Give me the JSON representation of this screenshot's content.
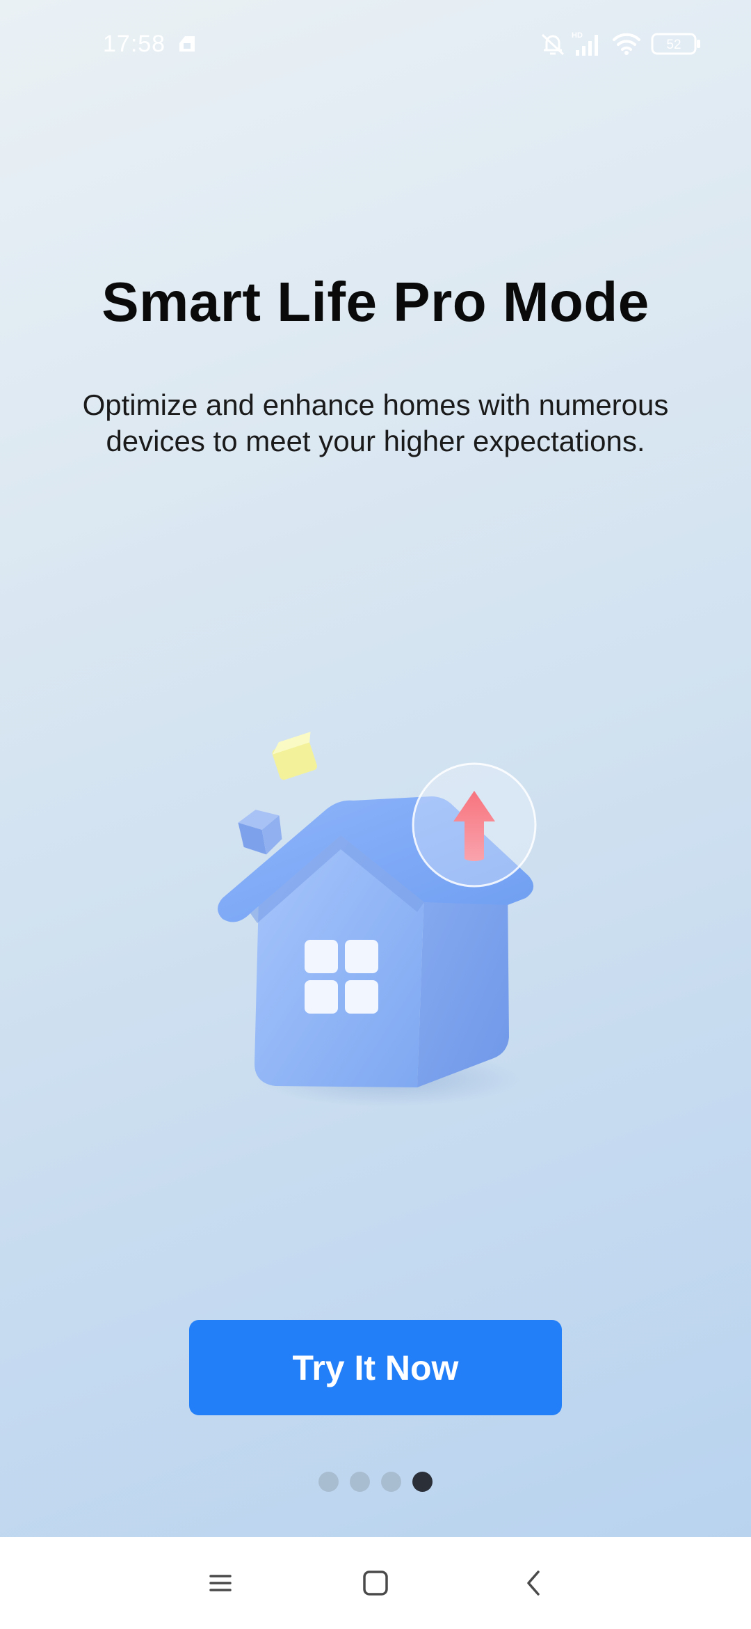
{
  "status_bar": {
    "time": "17:58",
    "battery_level": "52",
    "icons": [
      "sim-card-icon",
      "mute-icon",
      "hd-signal-icon",
      "wifi-icon",
      "battery-icon"
    ]
  },
  "onboarding": {
    "title": "Smart Life Pro Mode",
    "subtitle": "Optimize and enhance homes with numerous devices to meet your higher expectations.",
    "cta_label": "Try It Now",
    "page_count": 4,
    "current_page": 4
  },
  "nav_bar": {
    "icons": [
      "menu-icon",
      "home-square-icon",
      "back-icon"
    ]
  },
  "colors": {
    "accent": "#237ff8",
    "title": "#0a0a0a",
    "dot_active": "#2a2f38",
    "dot_inactive": "#a9bdd1"
  }
}
